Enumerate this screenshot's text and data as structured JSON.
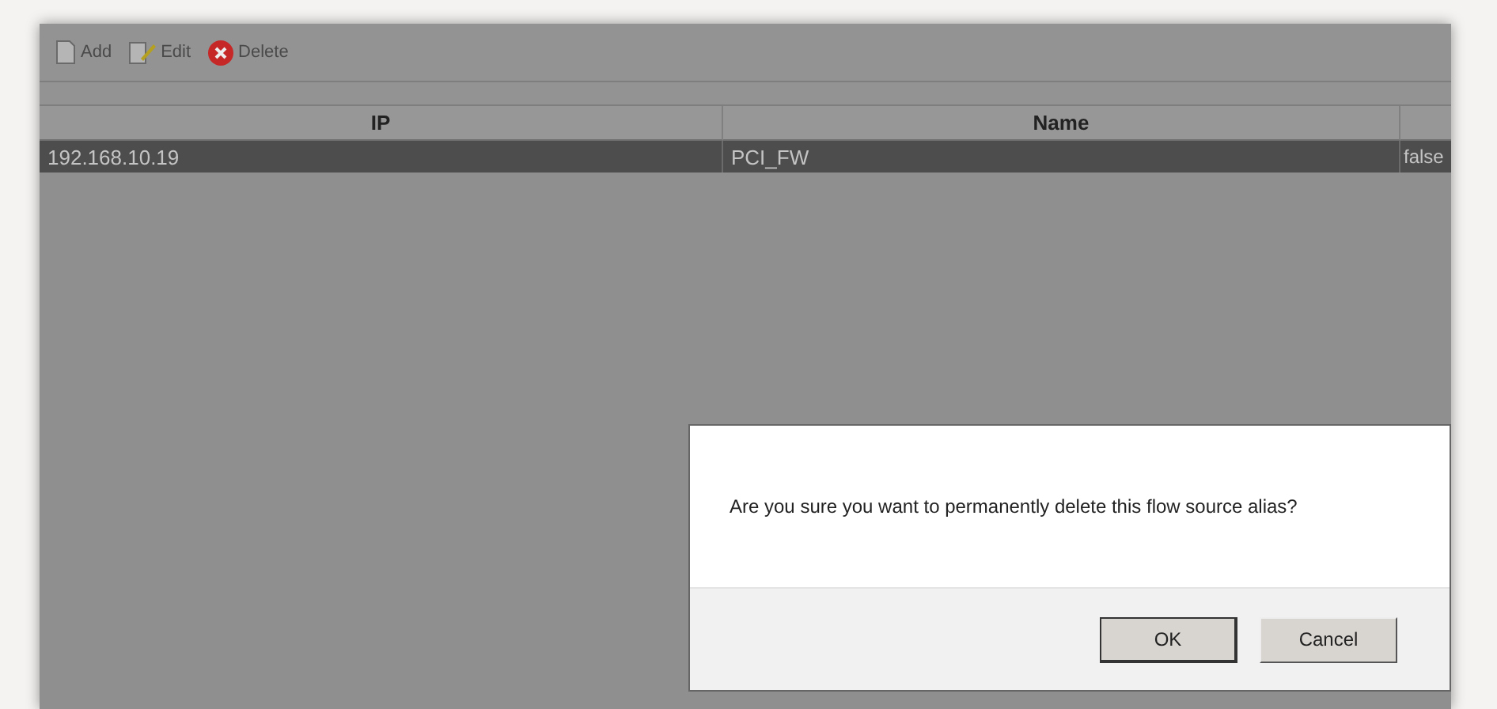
{
  "toolbar": [
    {
      "kind": "add",
      "label": "Add"
    },
    {
      "kind": "edit",
      "label": "Edit"
    },
    {
      "kind": "delete",
      "label": "Delete"
    }
  ],
  "table": {
    "columns": [
      "IP",
      "Name"
    ],
    "rows": [
      {
        "selected": true,
        "cells": [
          "192.168.10.19",
          "PCI_FW",
          "false"
        ]
      }
    ]
  },
  "dialog": {
    "message": "Are you sure you want to permanently delete this flow source alias?",
    "buttons": [
      {
        "label": "OK",
        "selected": true
      },
      {
        "label": "Cancel",
        "selected": false
      }
    ]
  }
}
